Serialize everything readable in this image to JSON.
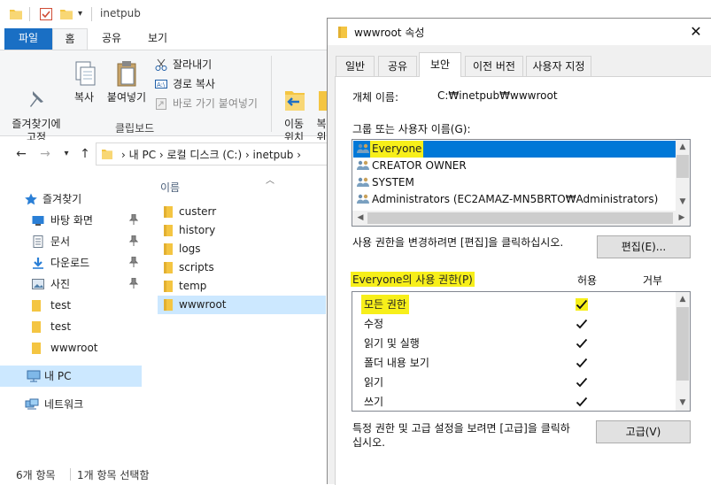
{
  "explorer": {
    "window_title": "inetpub",
    "ribbon_tabs": [
      "파일",
      "홈",
      "공유",
      "보기"
    ],
    "ribbon": {
      "pin_label": "즐겨찾기에\n고정",
      "copy_label": "복사",
      "paste_label": "붙여넣기",
      "cut_label": "잘라내기",
      "copy_path_label": "경로 복사",
      "paste_shortcut_label": "바로 가기 붙여넣기",
      "clipboard_group": "클립보드",
      "move_to_label": "이동\n위치",
      "copy_to_partial": "복\n위"
    },
    "address": {
      "path": "›  내 PC  ›  로컬 디스크 (C:)  ›  inetpub  ›"
    },
    "nav": {
      "items": [
        {
          "label": "즐겨찾기",
          "icon": "star-icon"
        },
        {
          "label": "바탕 화면",
          "icon": "desktop-icon",
          "pinned": true
        },
        {
          "label": "문서",
          "icon": "documents-icon",
          "pinned": true
        },
        {
          "label": "다운로드",
          "icon": "download-icon",
          "pinned": true
        },
        {
          "label": "사진",
          "icon": "pictures-icon",
          "pinned": true
        },
        {
          "label": "test",
          "icon": "folder-icon"
        },
        {
          "label": "test",
          "icon": "folder-icon"
        },
        {
          "label": "wwwroot",
          "icon": "folder-icon"
        },
        {
          "label": "내 PC",
          "icon": "pc-icon"
        },
        {
          "label": "네트워크",
          "icon": "network-icon"
        }
      ]
    },
    "files": {
      "column_name": "이름",
      "items": [
        "custerr",
        "history",
        "logs",
        "scripts",
        "temp",
        "wwwroot"
      ]
    },
    "status": {
      "count": "6개 항목",
      "selected": "1개 항목 선택함"
    }
  },
  "dialog": {
    "title": "wwwroot 속성",
    "tabs": [
      "일반",
      "공유",
      "보안",
      "이전 버전",
      "사용자 지정"
    ],
    "object_name_label": "개체 이름:",
    "object_name_value": "C:₩inetpub₩wwwroot",
    "group_label": "그룹 또는 사용자 이름(G):",
    "users": [
      "Everyone",
      "CREATOR OWNER",
      "SYSTEM",
      "Administrators (EC2AMAZ-MN5BRTO₩Administrators)"
    ],
    "change_hint": "사용 권한을 변경하려면 [편집]을 클릭하십시오.",
    "edit_button": "편집(E)...",
    "permissions_label": "Everyone의 사용 권한(P)",
    "allow_header": "허용",
    "deny_header": "거부",
    "permissions": [
      {
        "name": "모든 권한",
        "allow": true,
        "deny": false
      },
      {
        "name": "수정",
        "allow": true,
        "deny": false
      },
      {
        "name": "읽기 및 실행",
        "allow": true,
        "deny": false
      },
      {
        "name": "폴더 내용 보기",
        "allow": true,
        "deny": false
      },
      {
        "name": "읽기",
        "allow": true,
        "deny": false
      },
      {
        "name": "쓰기",
        "allow": true,
        "deny": false
      }
    ],
    "advanced_hint_1": "특정 권한 및 고급 설정을 보려면 [고급]을 클릭하",
    "advanced_hint_2": "십시오.",
    "advanced_button": "고급(V)"
  },
  "colors": {
    "accent": "#1a6fc4",
    "selection": "#cce8ff",
    "list_selection": "#0078d7",
    "highlight": "#f7ef1a",
    "folder": "#f4c542"
  }
}
